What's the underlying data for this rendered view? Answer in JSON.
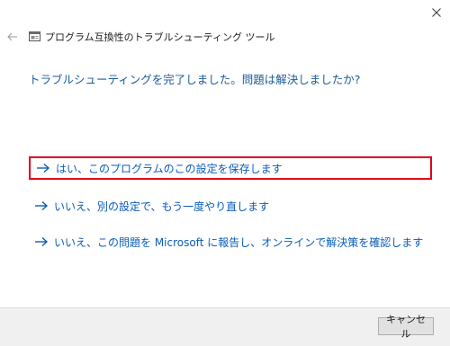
{
  "window": {
    "title": "プログラム互換性のトラブルシューティング ツール",
    "close_icon": "close-icon",
    "back_icon": "back-arrow-icon",
    "app_icon": "troubleshooter-app-icon"
  },
  "main": {
    "heading": "トラブルシューティングを完了しました。問題は解決しましたか?",
    "options": [
      {
        "label": "はい、このプログラムのこの設定を保存します",
        "icon": "arrow-right-icon",
        "highlighted": true
      },
      {
        "label": "いいえ、別の設定で、もう一度やり直します",
        "icon": "arrow-right-icon",
        "highlighted": false
      },
      {
        "label": "いいえ、この問題を Microsoft に報告し、オンラインで解決策を確認します",
        "icon": "arrow-right-icon",
        "highlighted": false
      }
    ]
  },
  "footer": {
    "cancel_label": "キャンセル"
  },
  "colors": {
    "link": "#0a5cb8",
    "heading": "#1a5a9a",
    "highlight_border": "#e3001b",
    "footer_bg": "#f0f0f0"
  }
}
